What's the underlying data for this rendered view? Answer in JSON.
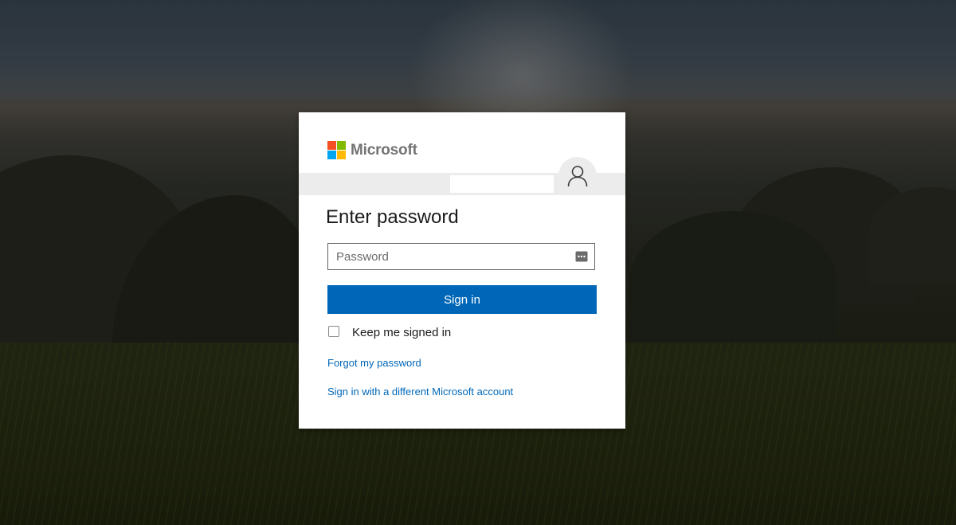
{
  "brand": {
    "name": "Microsoft",
    "logo_colors": [
      "#f25022",
      "#7fba00",
      "#00a4ef",
      "#ffb900"
    ]
  },
  "identity": {
    "email": "",
    "avatar_icon": "user-icon"
  },
  "form": {
    "title": "Enter password",
    "password_placeholder": "Password",
    "reveal_icon": "password-reveal-icon",
    "signin_label": "Sign in",
    "keep_signed_in_label": "Keep me signed in",
    "keep_signed_in_checked": false
  },
  "links": {
    "forgot_password": "Forgot my password",
    "different_account": "Sign in with a different Microsoft account"
  },
  "colors": {
    "accent": "#0067b8",
    "text": "#1b1b1b",
    "card_bg": "#ffffff",
    "band_bg": "#ececec"
  }
}
